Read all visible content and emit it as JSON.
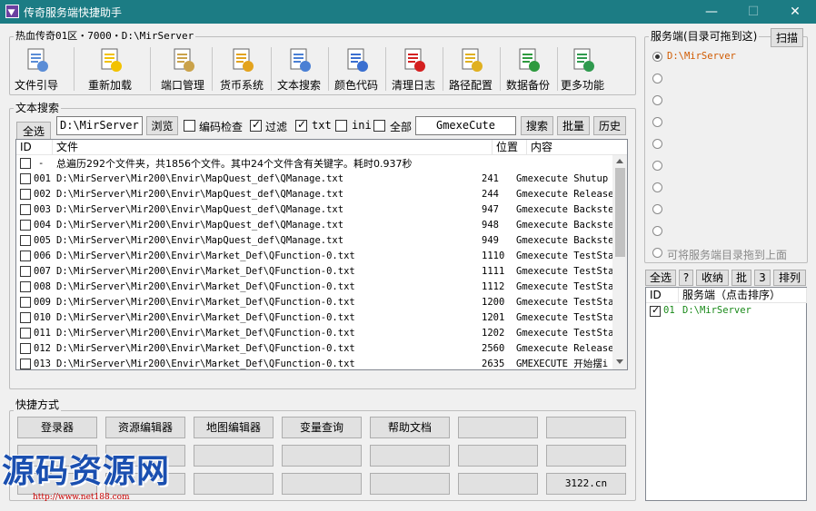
{
  "window": {
    "title": "传奇服务端快捷助手",
    "min": "—",
    "max": "☐",
    "close": "✕"
  },
  "server_group": {
    "label": "热血传奇01区・7000・D:\\MirServer"
  },
  "toolbar": [
    {
      "label": "文件引导",
      "icon": "files-icon",
      "dropdown": true
    },
    {
      "label": "重新加载",
      "icon": "reload-warning-icon",
      "dropdown": true
    },
    {
      "label": "端口管理",
      "icon": "port-gear-icon",
      "dropdown": false
    },
    {
      "label": "货币系统",
      "icon": "currency-doc-icon",
      "dropdown": false
    },
    {
      "label": "文本搜索",
      "icon": "text-search-icon",
      "dropdown": false
    },
    {
      "label": "颜色代码",
      "icon": "color-code-doc-icon",
      "dropdown": false
    },
    {
      "label": "清理日志",
      "icon": "clear-log-icon",
      "dropdown": false
    },
    {
      "label": "路径配置",
      "icon": "folders-path-icon",
      "dropdown": false
    },
    {
      "label": "数据备份",
      "icon": "backup-doc-icon",
      "dropdown": false
    },
    {
      "label": "更多功能",
      "icon": "share-more-icon",
      "dropdown": true
    }
  ],
  "search": {
    "group_label": "文本搜索",
    "select_all": "全选",
    "path_value": "D:\\MirServer",
    "browse": "浏览",
    "opt_encoding": "编码检查",
    "opt_filter": "过滤",
    "opt_txt": "txt",
    "opt_ini": "ini",
    "opt_all": "全部",
    "keyword_value": "GmexeCute",
    "search_btn": "搜索",
    "batch_btn": "批量",
    "history_btn": "历史",
    "checks": {
      "encoding": false,
      "filter": true,
      "txt": true,
      "ini": false,
      "all": false
    }
  },
  "results": {
    "columns": [
      "ID",
      "文件",
      "位置",
      "内容"
    ],
    "summary": {
      "id": "-",
      "text": "总遍历292个文件夹，共1856个文件。其中24个文件含有关键字。耗时0.937秒"
    },
    "rows": [
      {
        "id": "001",
        "file": "D:\\MirServer\\Mir200\\Envir\\MapQuest_def\\QManage.txt",
        "pos": "241",
        "content": "Gmexecute Shutup"
      },
      {
        "id": "002",
        "file": "D:\\MirServer\\Mir200\\Envir\\MapQuest_def\\QManage.txt",
        "pos": "244",
        "content": "Gmexecute ReleaseS"
      },
      {
        "id": "003",
        "file": "D:\\MirServer\\Mir200\\Envir\\MapQuest_def\\QManage.txt",
        "pos": "947",
        "content": "Gmexecute Backstep"
      },
      {
        "id": "004",
        "file": "D:\\MirServer\\Mir200\\Envir\\MapQuest_def\\QManage.txt",
        "pos": "948",
        "content": "Gmexecute Backstep"
      },
      {
        "id": "005",
        "file": "D:\\MirServer\\Mir200\\Envir\\MapQuest_def\\QManage.txt",
        "pos": "949",
        "content": "Gmexecute Backstep"
      },
      {
        "id": "006",
        "file": "D:\\MirServer\\Mir200\\Envir\\Market_Def\\QFunction-0.txt",
        "pos": "1110",
        "content": "Gmexecute TestStat"
      },
      {
        "id": "007",
        "file": "D:\\MirServer\\Mir200\\Envir\\Market_Def\\QFunction-0.txt",
        "pos": "1111",
        "content": "Gmexecute TestStat"
      },
      {
        "id": "008",
        "file": "D:\\MirServer\\Mir200\\Envir\\Market_Def\\QFunction-0.txt",
        "pos": "1112",
        "content": "Gmexecute TestStat"
      },
      {
        "id": "009",
        "file": "D:\\MirServer\\Mir200\\Envir\\Market_Def\\QFunction-0.txt",
        "pos": "1200",
        "content": "Gmexecute TestStat"
      },
      {
        "id": "010",
        "file": "D:\\MirServer\\Mir200\\Envir\\Market_Def\\QFunction-0.txt",
        "pos": "1201",
        "content": "Gmexecute TestStat"
      },
      {
        "id": "011",
        "file": "D:\\MirServer\\Mir200\\Envir\\Market_Def\\QFunction-0.txt",
        "pos": "1202",
        "content": "Gmexecute TestStat"
      },
      {
        "id": "012",
        "file": "D:\\MirServer\\Mir200\\Envir\\Market_Def\\QFunction-0.txt",
        "pos": "2560",
        "content": "Gmexecute ReleaseS"
      },
      {
        "id": "013",
        "file": "D:\\MirServer\\Mir200\\Envir\\Market_Def\\QFunction-0.txt",
        "pos": "2635",
        "content": "GMEXECUTE 开始摆i"
      }
    ]
  },
  "shortcuts": {
    "label": "快捷方式",
    "row1": [
      "登录器",
      "资源编辑器",
      "地图编辑器",
      "变量查询",
      "帮助文档",
      "",
      ""
    ],
    "row2": [
      "",
      "",
      "",
      "",
      "",
      "",
      ""
    ],
    "row3": [
      "",
      "",
      "",
      "",
      "",
      "",
      "3122.cn"
    ]
  },
  "servers": {
    "label": "服务端(目录可拖到这)",
    "scan": "扫描",
    "items": [
      "D:\\MirServer",
      "",
      "",
      "",
      "",
      "",
      "",
      "",
      "",
      "可将服务端目录拖到上面"
    ],
    "selected_index": 0,
    "item_color": "#d05a00"
  },
  "server_list": {
    "select_all": "全选",
    "help": "?",
    "collapse": "收纳",
    "batch": "批",
    "count": "3",
    "sort": "排列",
    "columns": [
      "ID",
      "服务端（点击排序）"
    ],
    "rows": [
      {
        "id": "01",
        "path": "D:\\MirServer",
        "checked": true,
        "color": "#1a8a1a"
      }
    ]
  },
  "watermark": {
    "text": "源码资源网",
    "url": "http://www.net188.com"
  }
}
